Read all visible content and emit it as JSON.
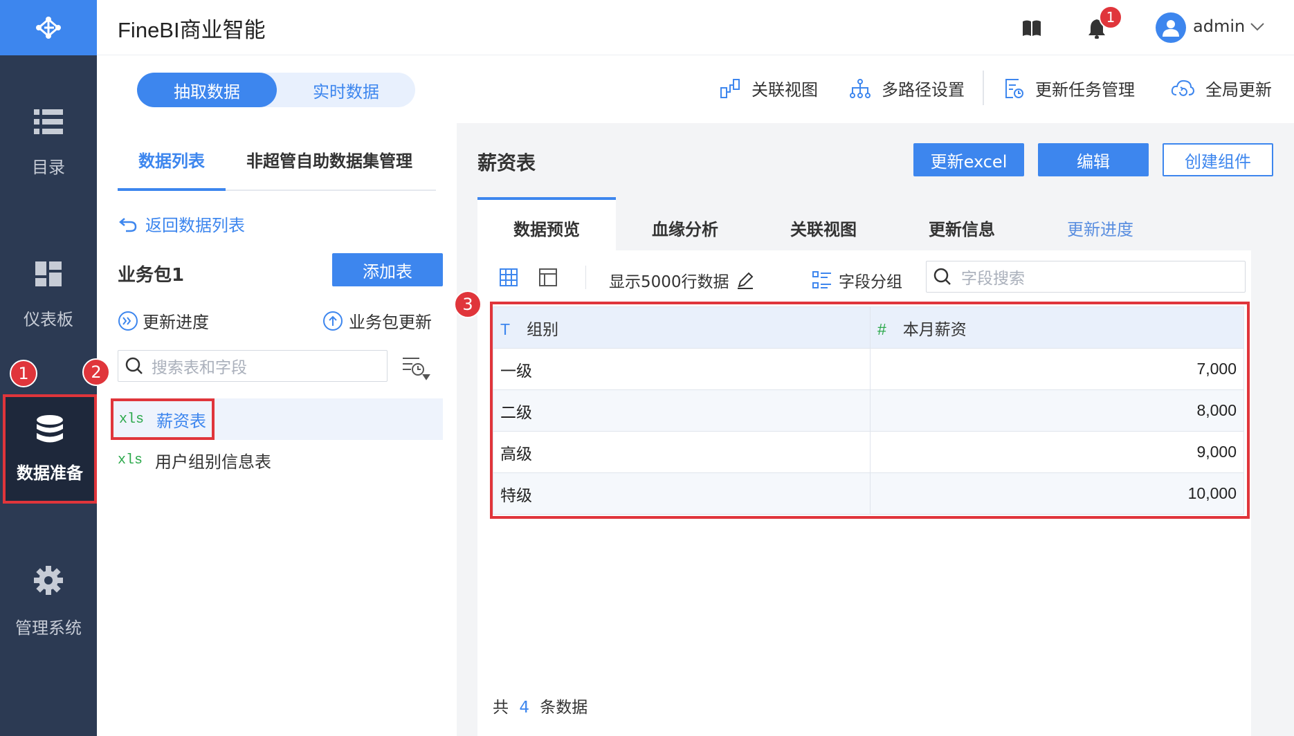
{
  "app": {
    "title": "FineBI商业智能",
    "user": "admin",
    "notification_count": "1"
  },
  "nav": {
    "items": [
      {
        "label": "目录",
        "icon": "list-icon"
      },
      {
        "label": "仪表板",
        "icon": "dashboard-icon"
      },
      {
        "label": "数据准备",
        "icon": "database-icon"
      },
      {
        "label": "管理系统",
        "icon": "gear-icon"
      }
    ]
  },
  "mode_toggle": {
    "extract": "抽取数据",
    "realtime": "实时数据"
  },
  "toolbar": {
    "relation_view": "关联视图",
    "multipath": "多路径设置",
    "update_tasks": "更新任务管理",
    "global_update": "全局更新"
  },
  "left": {
    "tabs": [
      "数据列表",
      "非超管自助数据集管理"
    ],
    "back_link": "返回数据列表",
    "package_name": "业务包1",
    "add_table": "添加表",
    "update_progress": "更新进度",
    "package_update": "业务包更新",
    "search_placeholder": "搜索表和字段",
    "tables": [
      {
        "type": "xls",
        "name": "薪资表"
      },
      {
        "type": "xls",
        "name": "用户组别信息表"
      }
    ]
  },
  "right": {
    "title": "薪资表",
    "buttons": {
      "update_excel": "更新excel",
      "edit": "编辑",
      "create_component": "创建组件"
    },
    "tabs": [
      "数据预览",
      "血缘分析",
      "关联视图",
      "更新信息",
      "更新进度"
    ],
    "row_limit": "显示5000行数据",
    "field_group": "字段分组",
    "field_search_placeholder": "字段搜索",
    "table": {
      "columns": [
        {
          "type": "T",
          "name": "组别"
        },
        {
          "type": "#",
          "name": "本月薪资"
        }
      ],
      "rows": [
        [
          "一级",
          "7,000"
        ],
        [
          "二级",
          "8,000"
        ],
        [
          "高级",
          "9,000"
        ],
        [
          "特级",
          "10,000"
        ]
      ]
    },
    "footer": {
      "prefix": "共",
      "count": "4",
      "suffix": "条数据"
    }
  },
  "annotations": {
    "step1": "1",
    "step2": "2",
    "step3": "3"
  },
  "colors": {
    "accent": "#3d86ee",
    "nav_bg": "#2c3a53",
    "highlight": "#e0353b",
    "xls": "#2aa84a"
  }
}
